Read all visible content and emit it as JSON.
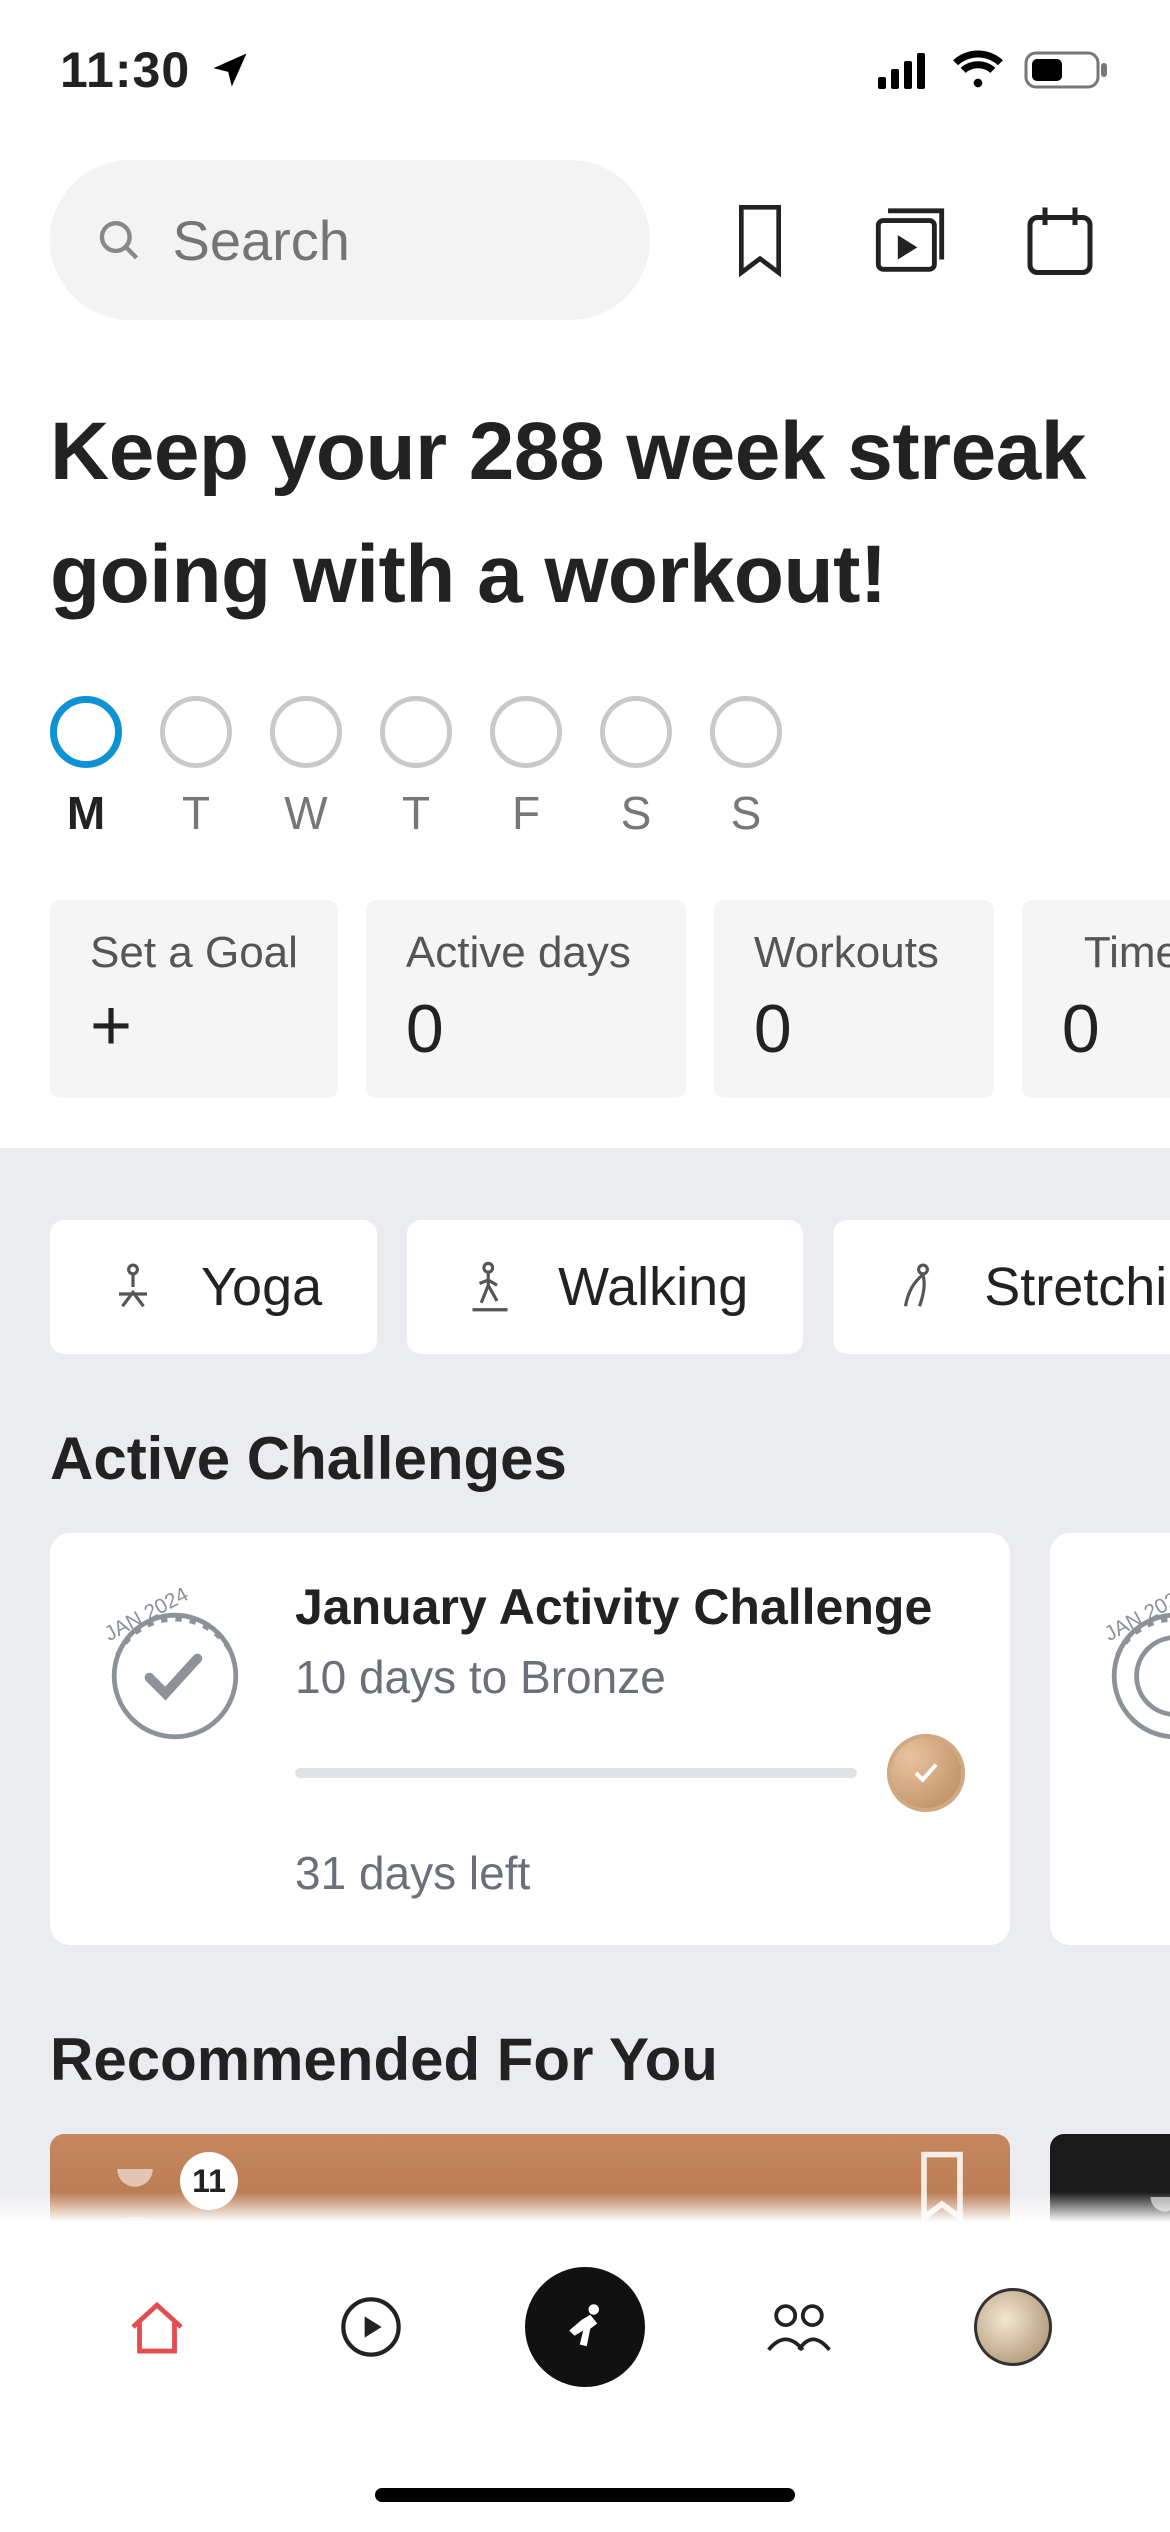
{
  "status": {
    "time": "11:30"
  },
  "search": {
    "placeholder": "Search"
  },
  "headline": "Keep your 288 week streak going with a workout!",
  "week": {
    "days": [
      "M",
      "T",
      "W",
      "T",
      "F",
      "S",
      "S"
    ],
    "today_index": 0
  },
  "stats": [
    {
      "title": "Set a Goal",
      "value": "+",
      "is_plus": true
    },
    {
      "title": "Active days",
      "value": "0"
    },
    {
      "title": "Workouts",
      "value": "0"
    },
    {
      "title": "Time",
      "value": "0"
    }
  ],
  "categories": [
    {
      "label": "Yoga"
    },
    {
      "label": "Walking"
    },
    {
      "label": "Stretching"
    }
  ],
  "sections": {
    "challenges": "Active Challenges",
    "recommended": "Recommended For You"
  },
  "challenge": {
    "badge_caption": "JAN 2024",
    "title": "January Activity Challenge",
    "subtitle": "10 days to Bronze",
    "days_left": "31 days left"
  },
  "recommended": {
    "count_badge": "11"
  }
}
